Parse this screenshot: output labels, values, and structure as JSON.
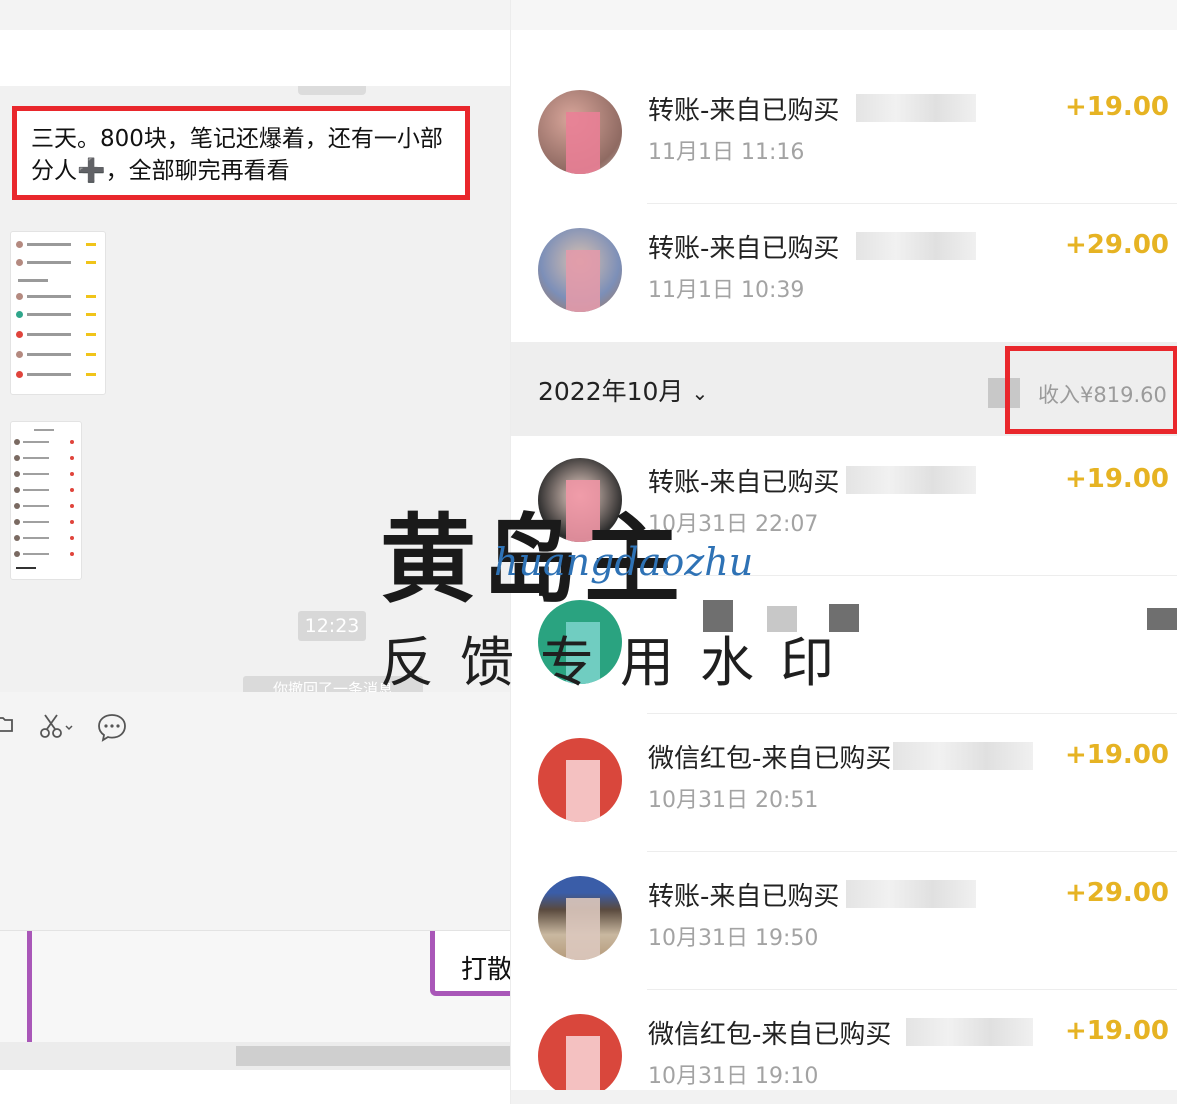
{
  "chat": {
    "message": "三天。800块，笔记还爆着，还有一小部分人➕，全部聊完再看看",
    "time": "12:23",
    "recall_notice": "你撤回了一条消息",
    "toolbar": {
      "folder_icon": "folder-icon",
      "scissors_icon": "scissors-icon",
      "chat_bubble_icon": "chat-bubble-icon"
    },
    "input_fragment": "打散"
  },
  "transactions_top": [
    {
      "title": "转账-来自已购买",
      "time": "11月1日 11:16",
      "amount": "+19.00"
    },
    {
      "title": "转账-来自已购买",
      "time": "11月1日 10:39",
      "amount": "+29.00"
    }
  ],
  "month": {
    "label": "2022年10月",
    "income": "收入¥819.60"
  },
  "transactions_bottom": [
    {
      "title": "转账-来自已购买",
      "time": "10月31日 22:07",
      "amount": "+19.00"
    },
    {
      "title": "微信红包-来自已购买",
      "time": "10月31日 20:51",
      "amount": "+19.00"
    },
    {
      "title": "转账-来自已购买",
      "time": "10月31日 19:50",
      "amount": "+29.00"
    },
    {
      "title": "微信红包-来自已购买",
      "time": "10月31日 19:10",
      "amount": "+19.00"
    }
  ],
  "watermark": {
    "main": "黄岛主",
    "script": "huangdaozhu",
    "sub": "反馈专用水印"
  },
  "colors": {
    "highlight_red": "#e9272c",
    "amount_gold": "#e6b323",
    "purple_accent": "#a957b8"
  }
}
